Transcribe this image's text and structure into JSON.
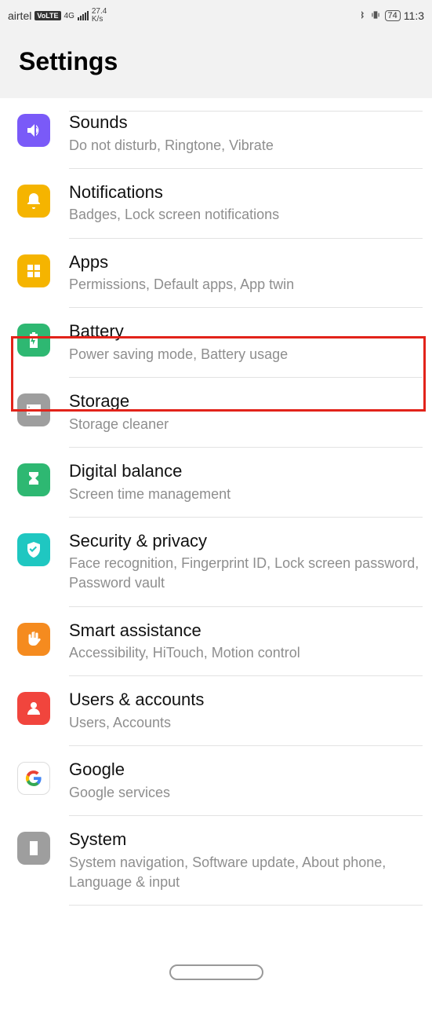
{
  "status": {
    "carrier": "airtel",
    "volte": "VoLTE",
    "net": "4G",
    "speed_top": "27.4",
    "speed_bot": "K/s",
    "battery": "74",
    "time": "11:3"
  },
  "header": {
    "title": "Settings"
  },
  "items": [
    {
      "title": "Sounds",
      "sub": "Do not disturb, Ringtone, Vibrate",
      "color": "#7a5af8",
      "icon": "sound"
    },
    {
      "title": "Notifications",
      "sub": "Badges, Lock screen notifications",
      "color": "#f5b400",
      "icon": "bell"
    },
    {
      "title": "Apps",
      "sub": "Permissions, Default apps, App twin",
      "color": "#f5b400",
      "icon": "grid"
    },
    {
      "title": "Battery",
      "sub": "Power saving mode, Battery usage",
      "color": "#2eb872",
      "icon": "battery"
    },
    {
      "title": "Storage",
      "sub": "Storage cleaner",
      "color": "#9e9e9e",
      "icon": "storage"
    },
    {
      "title": "Digital balance",
      "sub": "Screen time management",
      "color": "#2eb872",
      "icon": "hourglass"
    },
    {
      "title": "Security & privacy",
      "sub": "Face recognition, Fingerprint ID, Lock screen password, Password vault",
      "color": "#1fc7c1",
      "icon": "shield"
    },
    {
      "title": "Smart assistance",
      "sub": "Accessibility, HiTouch, Motion control",
      "color": "#f58b1f",
      "icon": "hand"
    },
    {
      "title": "Users & accounts",
      "sub": "Users, Accounts",
      "color": "#f1453d",
      "icon": "person"
    },
    {
      "title": "Google",
      "sub": "Google services",
      "color": "#ffffff",
      "icon": "google"
    },
    {
      "title": "System",
      "sub": "System navigation, Software update, About phone, Language & input",
      "color": "#9e9e9e",
      "icon": "system"
    }
  ]
}
